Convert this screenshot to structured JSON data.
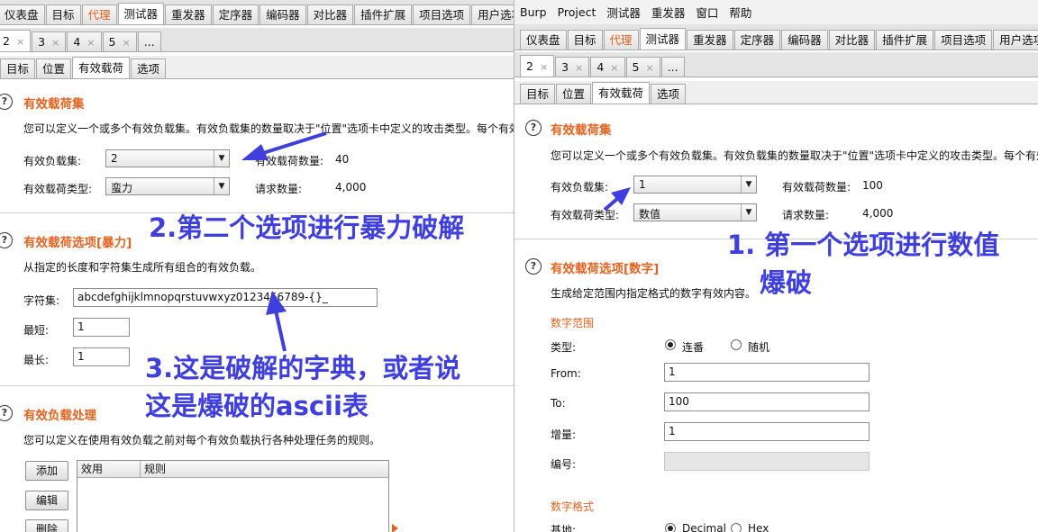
{
  "left": {
    "main_tabs": [
      "仪表盘",
      "目标",
      "代理",
      "测试器",
      "重发器",
      "定序器",
      "编码器",
      "对比器",
      "插件扩展",
      "项目选项",
      "用户选项"
    ],
    "sub_tabs": [
      {
        "label": "2",
        "close": "×"
      },
      {
        "label": "3",
        "close": "×"
      },
      {
        "label": "4",
        "close": "×"
      },
      {
        "label": "5",
        "close": "×"
      },
      {
        "label": "..."
      }
    ],
    "inner_tabs": [
      "目标",
      "位置",
      "有效载荷",
      "选项"
    ],
    "payload_sets": {
      "help": "?",
      "title": "有效载荷集",
      "desc": "您可以定义一个或多个有效负载集。有效负载集的数量取决于\"位置\"选项卡中定义的攻击类型。每个有效",
      "set_label": "有效负载集:",
      "set_value": "2",
      "type_label": "有效载荷类型:",
      "type_value": "蛮力",
      "count_label": "有效载荷数量:",
      "count_value": "40",
      "req_label": "请求数量:",
      "req_value": "4,000"
    },
    "payload_options": {
      "help": "?",
      "title": "有效载荷选项[暴力]",
      "desc": "从指定的长度和字符集生成所有组合的有效负载。",
      "charset_label": "字符集:",
      "charset_value": "abcdefghijklmnopqrstuvwxyz0123456789-{}_",
      "min_label": "最短:",
      "min_value": "1",
      "max_label": "最长:",
      "max_value": "1"
    },
    "processing": {
      "help": "?",
      "title": "有效负载处理",
      "desc": "您可以定义在使用有效负载之前对每个有效负载执行各种处理任务的规则。",
      "buttons": [
        "添加",
        "编辑",
        "删除"
      ],
      "columns": [
        "效用",
        "规则"
      ]
    }
  },
  "right": {
    "menu": [
      "Burp",
      "Project",
      "测试器",
      "重发器",
      "窗口",
      "帮助"
    ],
    "main_tabs": [
      "仪表盘",
      "目标",
      "代理",
      "测试器",
      "重发器",
      "定序器",
      "编码器",
      "对比器",
      "插件扩展",
      "项目选项",
      "用户选项"
    ],
    "sub_tabs": [
      {
        "label": "2",
        "close": "×"
      },
      {
        "label": "3",
        "close": "×"
      },
      {
        "label": "4",
        "close": "×"
      },
      {
        "label": "5",
        "close": "×"
      },
      {
        "label": "..."
      }
    ],
    "inner_tabs": [
      "目标",
      "位置",
      "有效载荷",
      "选项"
    ],
    "payload_sets": {
      "help": "?",
      "title": "有效载荷集",
      "desc": "您可以定义一个或多个有效负载集。有效负载集的数量取决于\"位置\"选项卡中定义的攻击类型。每个有效",
      "set_label": "有效负载集:",
      "set_value": "1",
      "type_label": "有效载荷类型:",
      "type_value": "数值",
      "count_label": "有效载荷数量:",
      "count_value": "100",
      "req_label": "请求数量:",
      "req_value": "4,000"
    },
    "payload_options": {
      "help": "?",
      "title": "有效载荷选项[数字]",
      "desc": "生成给定范围内指定格式的数字有效内容。",
      "range_title": "数字范围",
      "type_label": "类型:",
      "opt_seq": "连番",
      "opt_rand": "随机",
      "from_label": "From:",
      "from_value": "1",
      "to_label": "To:",
      "to_value": "100",
      "step_label": "增量:",
      "step_value": "1",
      "num_label": "编号:",
      "format_title": "数字格式",
      "base_label": "基地:",
      "opt_dec": "Decimal",
      "opt_hex": "Hex"
    }
  },
  "annotations": {
    "a1_line1": "1. 第一个选项进行数值",
    "a1_line2": "爆破",
    "a2": "2.第二个选项进行暴力破解",
    "a3_line1": "3.这是破解的字典，或者说",
    "a3_line2": "这是爆破的ascii表"
  },
  "colors": {
    "accent": "#e5621f",
    "annotation": "#3f3fdd"
  }
}
